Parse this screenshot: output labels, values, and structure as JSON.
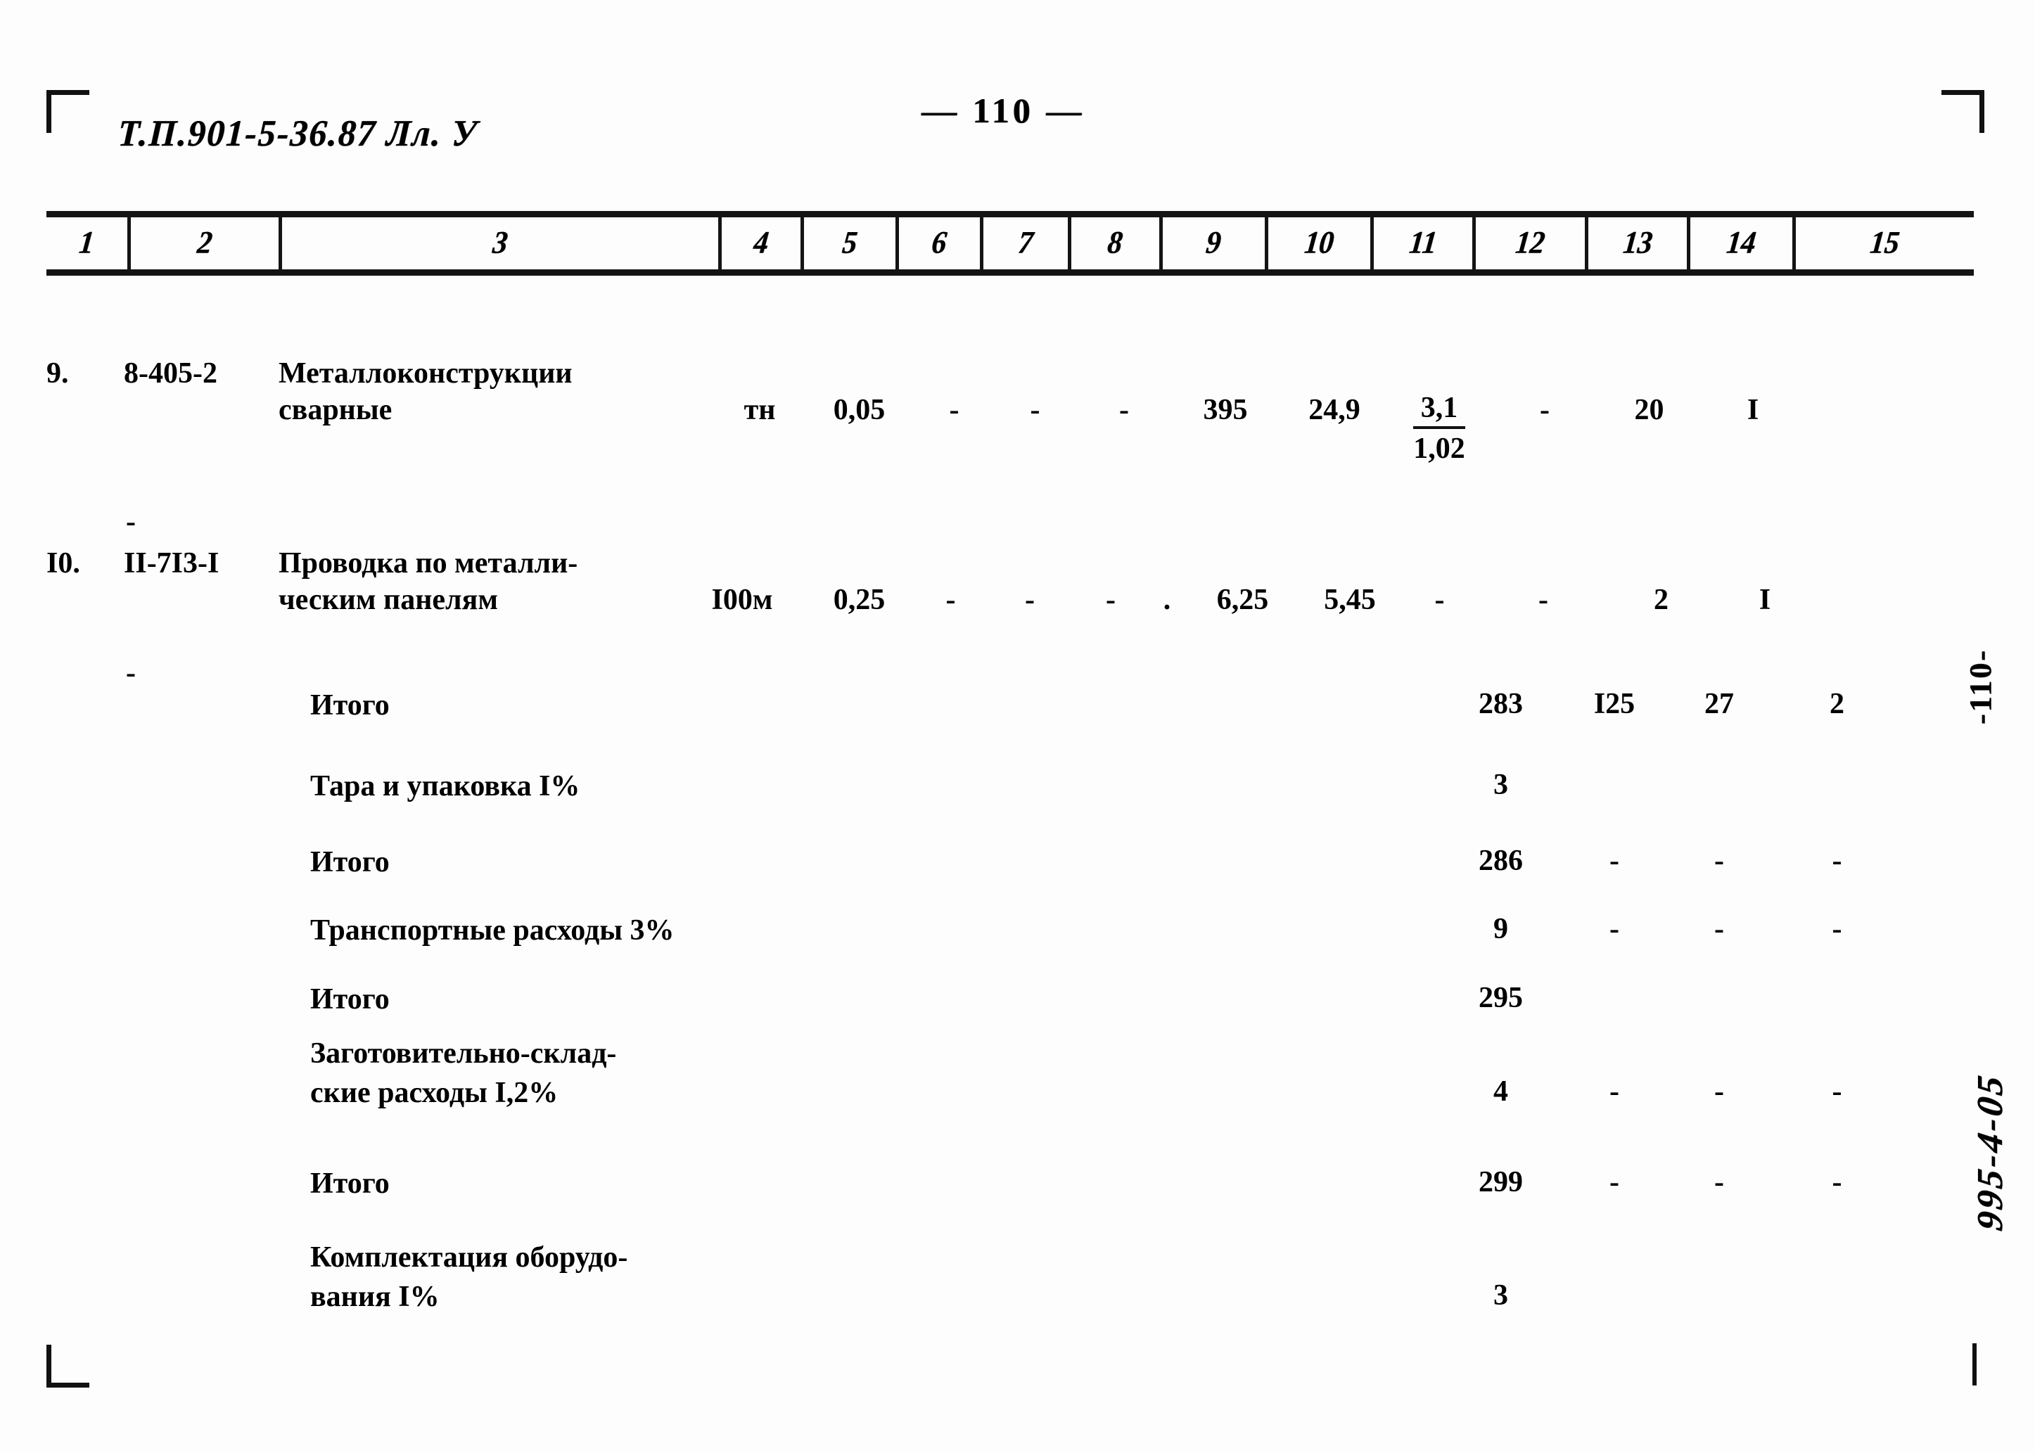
{
  "document": {
    "code": "Т.П.901-5-36.87 Лл. У",
    "page_number": "110",
    "page_marker_top": "— 110 —",
    "side_marker_page": "-110-",
    "side_marker_handwritten": "995-4-05"
  },
  "table": {
    "column_numbers": [
      "1",
      "2",
      "3",
      "4",
      "5",
      "6",
      "7",
      "8",
      "9",
      "10",
      "11",
      "12",
      "13",
      "14",
      "15"
    ],
    "rows": [
      {
        "no": "9.",
        "code": "8-405-2",
        "name_line1": "Металлоконструкции",
        "name_line2": "сварные",
        "unit": "тн",
        "c5": "0,05",
        "c6": "-",
        "c7": "-",
        "c8": "-",
        "c9": "395",
        "c10": "24,9",
        "c11_num": "3,1",
        "c11_den": "1,02",
        "c12": "-",
        "c13": "20",
        "c14": "I",
        "c15": "-"
      },
      {
        "no": "I0.",
        "code": "II-7I3-I",
        "name_line1": "Проводка по металли-",
        "name_line2": "ческим панелям",
        "unit": "I00м",
        "c5": "0,25",
        "c6": "-",
        "c7": "-",
        "c8": "-",
        "c8b": ".",
        "c9": "6,25",
        "c10": "5,45",
        "c11": "-",
        "c12": "-",
        "c13": "2",
        "c14": "I",
        "c15": "-"
      }
    ],
    "summary": [
      {
        "label": "Итого",
        "c12": "283",
        "c13": "I25",
        "c14": "27",
        "c15": "2"
      },
      {
        "label": "Тара и упаковка I%",
        "c12": "3",
        "c13": "",
        "c14": "",
        "c15": ""
      },
      {
        "label": "Итого",
        "c12": "286",
        "c13": "-",
        "c14": "-",
        "c15": "-"
      },
      {
        "label": "Транспортные расходы 3%",
        "c12": "9",
        "c13": "-",
        "c14": "-",
        "c15": "-"
      },
      {
        "label": "Итого",
        "c12": "295",
        "c13": "",
        "c14": "",
        "c15": ""
      },
      {
        "label_line1": "Заготовительно-склад-",
        "label_line2": "ские расходы I,2%",
        "c12": "4",
        "c13": "-",
        "c14": "-",
        "c15": "-"
      },
      {
        "label": "Итого",
        "c12": "299",
        "c13": "-",
        "c14": "-",
        "c15": "-"
      },
      {
        "label_line1": "Комплектация оборудо-",
        "label_line2": "вания I%",
        "c12": "3",
        "c13": "",
        "c14": "",
        "c15": ""
      }
    ]
  }
}
